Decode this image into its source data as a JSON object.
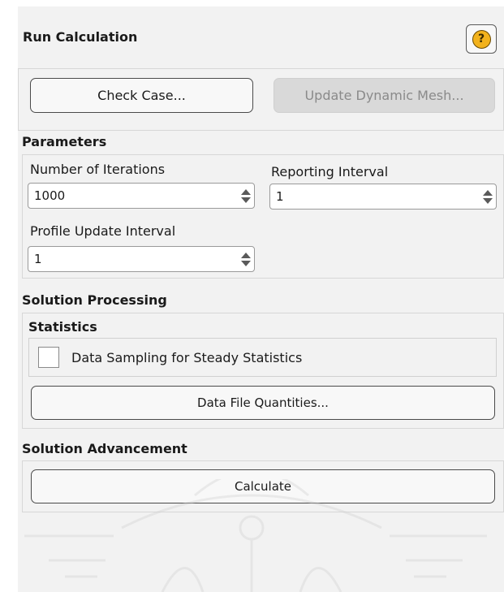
{
  "panel": {
    "title": "Run Calculation",
    "help_icon": "question-mark-icon",
    "help_symbol": "?"
  },
  "actions": {
    "check_case": "Check Case...",
    "update_dynamic_mesh": "Update Dynamic Mesh..."
  },
  "parameters": {
    "heading": "Parameters",
    "iterations_label": "Number of Iterations",
    "iterations_value": "1000",
    "reporting_label": "Reporting Interval",
    "reporting_value": "1",
    "profile_label": "Profile Update Interval",
    "profile_value": "1"
  },
  "solution_processing": {
    "heading": "Solution Processing",
    "statistics_heading": "Statistics",
    "data_sampling_label": "Data Sampling for Steady Statistics",
    "data_sampling_checked": false,
    "data_file_quantities": "Data File Quantities..."
  },
  "solution_advancement": {
    "heading": "Solution Advancement",
    "calculate": "Calculate"
  },
  "colors": {
    "panel_bg": "#f2f2f2",
    "help_icon": "#f2b21c",
    "disabled_button": "#d9d9d9"
  }
}
